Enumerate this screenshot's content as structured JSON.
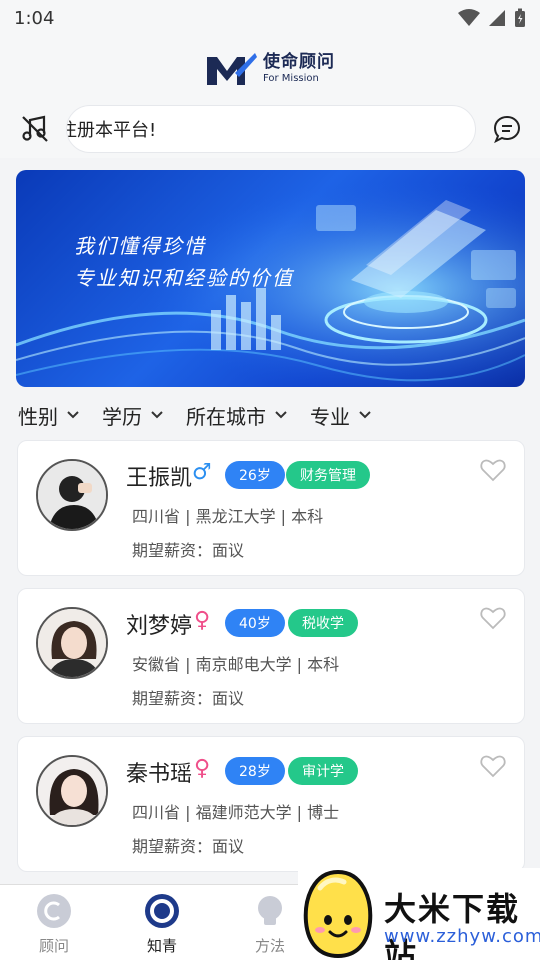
{
  "status_bar": {
    "time": "1:04"
  },
  "header": {
    "logo_cn": "使命顾问",
    "logo_en": "For Mission"
  },
  "notice": {
    "text": "注册本平台!"
  },
  "banner": {
    "line1": "我们懂得珍惜",
    "line2": "专业知识和经验的价值"
  },
  "filters": [
    {
      "label": "性别"
    },
    {
      "label": "学历"
    },
    {
      "label": "所在城市"
    },
    {
      "label": "专业"
    }
  ],
  "cards": [
    {
      "name": "王振凯",
      "gender": "♂",
      "gender_color": "#2b8ff0",
      "age": "26岁",
      "field": "财务管理",
      "info": "四川省 | 黑龙江大学 | 本科",
      "salary": "期望薪资：面议"
    },
    {
      "name": "刘梦婷",
      "gender": "♀",
      "gender_color": "#ef4f8a",
      "age": "40岁",
      "field": "税收学",
      "info": "安徽省 | 南京邮电大学 | 本科",
      "salary": "期望薪资：面议"
    },
    {
      "name": "秦书瑶",
      "gender": "♀",
      "gender_color": "#ef4f8a",
      "age": "28岁",
      "field": "审计学",
      "info": "四川省 | 福建师范大学 | 博士",
      "salary": "期望薪资：面议"
    }
  ],
  "tabs": [
    {
      "label": "顾问",
      "icon": "consultant-icon",
      "active": false
    },
    {
      "label": "知青",
      "icon": "youth-icon",
      "active": true
    },
    {
      "label": "方法",
      "icon": "bulb-icon",
      "active": false
    }
  ],
  "watermark": {
    "title": "大米下载站",
    "url": "www.zzhyw.com"
  },
  "colors": {
    "accent_blue": "#2f83f5",
    "accent_green": "#24c88a",
    "brand_navy": "#1c2a55"
  }
}
